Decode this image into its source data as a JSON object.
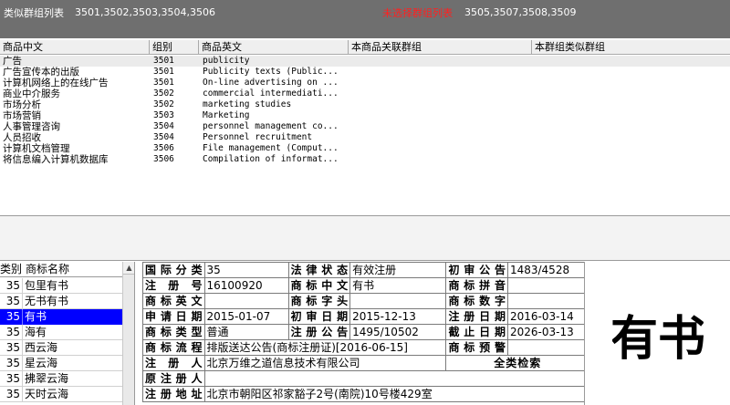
{
  "header": {
    "similar_title": "类似群组列表",
    "similar_ids": "3501,3502,3503,3504,3506",
    "unselected_title": "未选择群组列表",
    "unselected_ids": "3505,3507,3508,3509",
    "accent_color": "#ff2020"
  },
  "goods": {
    "columns": [
      "商品中文",
      "组别",
      "商品英文",
      "本商品关联群组",
      "本群组类似群组"
    ],
    "rows": [
      {
        "cn": "广告",
        "group": "3501",
        "en": "publicity"
      },
      {
        "cn": "广告宣传本的出版",
        "group": "3501",
        "en": "Publicity texts (Public..."
      },
      {
        "cn": "计算机网络上的在线广告",
        "group": "3501",
        "en": "On-line advertising on ..."
      },
      {
        "cn": "商业中介服务",
        "group": "3502",
        "en": "commercial intermediati..."
      },
      {
        "cn": "市场分析",
        "group": "3502",
        "en": "marketing studies"
      },
      {
        "cn": "市场营销",
        "group": "3503",
        "en": "Marketing"
      },
      {
        "cn": "人事管理咨询",
        "group": "3504",
        "en": "personnel management co..."
      },
      {
        "cn": "人员招收",
        "group": "3504",
        "en": "Personnel recruitment"
      },
      {
        "cn": "计算机文档管理",
        "group": "3506",
        "en": "File management (Comput..."
      },
      {
        "cn": "将信息编入计算机数据库",
        "group": "3506",
        "en": "Compilation of informat..."
      }
    ]
  },
  "tm_list": {
    "columns": [
      "类别",
      "商标名称"
    ],
    "rows": [
      {
        "cls": "35",
        "name": "包里有书"
      },
      {
        "cls": "35",
        "name": "无书有书"
      },
      {
        "cls": "35",
        "name": "有书"
      },
      {
        "cls": "35",
        "name": "海有"
      },
      {
        "cls": "35",
        "name": "西云海"
      },
      {
        "cls": "35",
        "name": "星云海"
      },
      {
        "cls": "35",
        "name": "拂翠云海"
      },
      {
        "cls": "35",
        "name": "天时云海"
      }
    ],
    "selected_index": 2,
    "selection_color": "#0000ff"
  },
  "detail": {
    "intl_class_label": "国际分类",
    "intl_class": "35",
    "legal_status_label": "法律状态",
    "legal_status": "有效注册",
    "prelim_notice_label": "初审公告",
    "prelim_notice": "1483/4528",
    "reg_no_label": "注 册 号",
    "reg_no": "16100920",
    "cn_mark_label": "商标中文",
    "cn_mark": "有书",
    "pinyin_label": "商标拼音",
    "pinyin": "",
    "en_mark_label": "商标英文",
    "en_mark": "",
    "letters_label": "商标字头",
    "letters": "",
    "digits_label": "商标数字",
    "digits": "",
    "apply_date_label": "申请日期",
    "apply_date": "2015-01-07",
    "prelim_date_label": "初审日期",
    "prelim_date": "2015-12-13",
    "reg_date_label": "注册日期",
    "reg_date": "2016-03-14",
    "mark_type_label": "商标类型",
    "mark_type": "普通",
    "reg_notice_label": "注册公告",
    "reg_notice": "1495/10502",
    "expiry_date_label": "截止日期",
    "expiry_date": "2026-03-13",
    "flow_label": "商标流程",
    "flow": "排版送达公告(商标注册证)[2016-06-15]",
    "warning_label": "商标预警",
    "warning": "",
    "registrant_label": "注 册 人",
    "registrant": "北京万维之道信息技术有限公司",
    "search_label": "全类检索",
    "orig_registrant_label": "原注册人",
    "orig_registrant": "",
    "address_label": "注册地址",
    "address": "北京市朝阳区祁家豁子2号(南院)10号楼429室"
  },
  "logo": {
    "text": "有书"
  }
}
